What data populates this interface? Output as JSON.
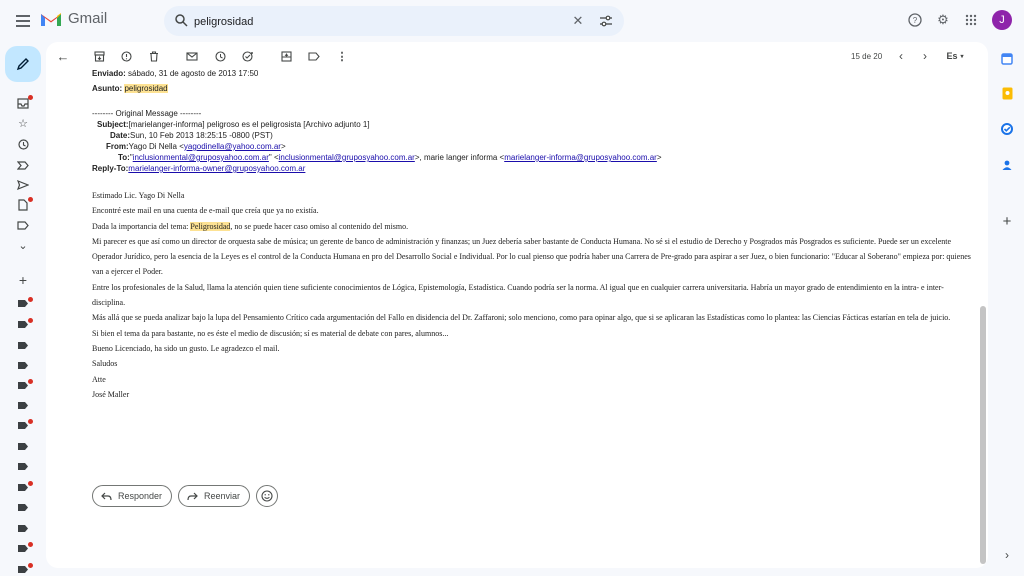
{
  "app": {
    "name": "Gmail",
    "avatar_initial": "J"
  },
  "search": {
    "query": "peligrosidad"
  },
  "pager": {
    "text": "15 de 20",
    "lang": "Es"
  },
  "email": {
    "sent_label": "Enviado:",
    "sent_value": "sábado, 31 de agosto de 2013 17:50",
    "subject_label": "Asunto:",
    "subject_value": "peligrosidad",
    "orig_sep": "-------- Original Message --------",
    "subj2_label": "Subject:",
    "subj2_value": "[marielanger-informa] peligroso es el peligrosista [Archivo adjunto 1]",
    "date_label": "Date:",
    "date_value": "Sun, 10 Feb 2013 18:25:15 -0800 (PST)",
    "from_label": "From:",
    "from_name": "Yago Di Nella <",
    "from_email": "yagodinella@yahoo.com.ar",
    "from_close": ">",
    "to_label": "To:",
    "to_q1": "\"",
    "to_email1": "inclusionmental@gruposyahoo.com.ar",
    "to_q2": "\" <",
    "to_email2": "inclusionmental@gruposyahoo.com.ar",
    "to_mid": ">, marie langer informa <",
    "to_email3": "marielanger-informa@gruposyahoo.com.ar",
    "to_close": ">",
    "reply_label": "Reply-To:",
    "reply_email": "marielanger-informa-owner@gruposyahoo.com.ar",
    "greeting": "Estimado Lic. Yago Di Nella",
    "p1": "Encontré este mail en una cuenta de e-mail que creía que ya no existía.",
    "p2_a": "Dada la importancia del tema: ",
    "p2_hl": "Peligrosidad",
    "p2_b": ", no se puede hacer caso omiso al contenido del mismo.",
    "p3": "Mi parecer es que así como un director de orquesta sabe de música; un gerente de banco de administración y finanzas; un Juez debería saber bastante de Conducta Humana. No sé si el estudio de Derecho y Posgrados más Posgrados es suficiente. Puede ser un excelente Operador Jurídico, pero la esencia de la Leyes es el control de la Conducta Humana en pro del Desarrollo Social e Individual. Por lo cual pienso que podría haber una Carrera de Pre-grado para aspirar a ser Juez, o bien funcionario: \"Educar al Soberano\" empieza por: quienes van a ejercer el Poder.",
    "p4": "Entre los profesionales de la Salud, llama la atención quien tiene suficiente conocimientos de Lógica, Epistemología, Estadística. Cuando podría ser la norma. Al igual que en cualquier carrera universitaria. Habría un mayor grado de entendimiento en la intra- e inter-disciplina.",
    "p5": "Más allá que se pueda analizar bajo la lupa del Pensamiento Crítico cada argumentación del Fallo en disidencia del Dr. Zaffaroni; solo menciono, como para opinar algo, que si se aplicaran las Estadísticas como lo plantea: las Ciencias Fácticas estarían en tela de juicio.",
    "p6": "Si bien el tema da para bastante, no es éste el medio de discusión; sí es material de debate con pares, alumnos...",
    "p7": "Bueno Licenciado, ha sido un gusto. Le agradezco el mail.",
    "p8": "Saludos",
    "p9": "Atte",
    "p10": "José Maller"
  },
  "actions": {
    "reply": "Responder",
    "forward": "Reenviar"
  },
  "colors": {
    "accent": "#c2e7ff",
    "highlight": "#fde293",
    "link": "#1a0dab",
    "unread_dot": "#d93025"
  }
}
